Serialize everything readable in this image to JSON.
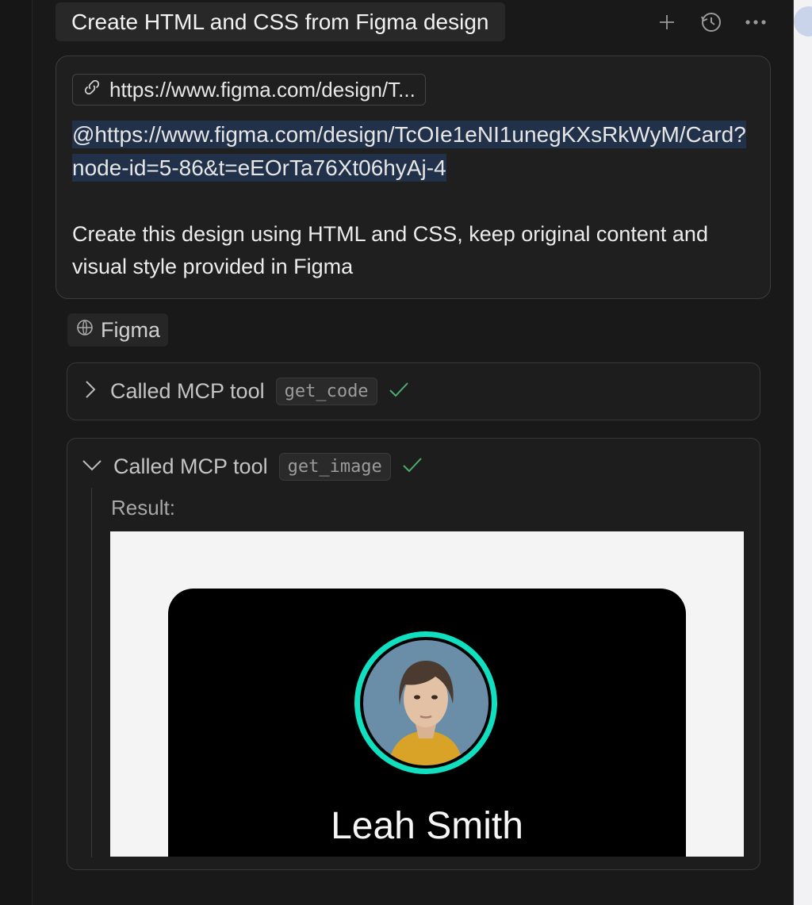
{
  "header": {
    "title": "Create HTML and CSS from Figma design",
    "icons": [
      "plus-icon",
      "history-icon",
      "more-icon"
    ]
  },
  "prompt": {
    "link_chip_label": "https://www.figma.com/design/T...",
    "mention": "@https://www.figma.com/design/TcOIe1eNI1unegKXsRkWyM/Card?node-id=5-86&t=eEOrTa76Xt06hyAj-4",
    "text": "Create this design using HTML and CSS, keep original content and visual style provided in Figma"
  },
  "source": {
    "label": "Figma"
  },
  "tools": [
    {
      "label": "Called MCP tool",
      "name": "get_code",
      "expanded": false
    },
    {
      "label": "Called MCP tool",
      "name": "get_image",
      "expanded": true
    }
  ],
  "result": {
    "label": "Result:",
    "preview_name": "Leah Smith"
  },
  "colors": {
    "background": "#191919",
    "accent_ring": "#10dfc0",
    "success": "#4caf6e",
    "mention_highlight": "#22314a"
  }
}
